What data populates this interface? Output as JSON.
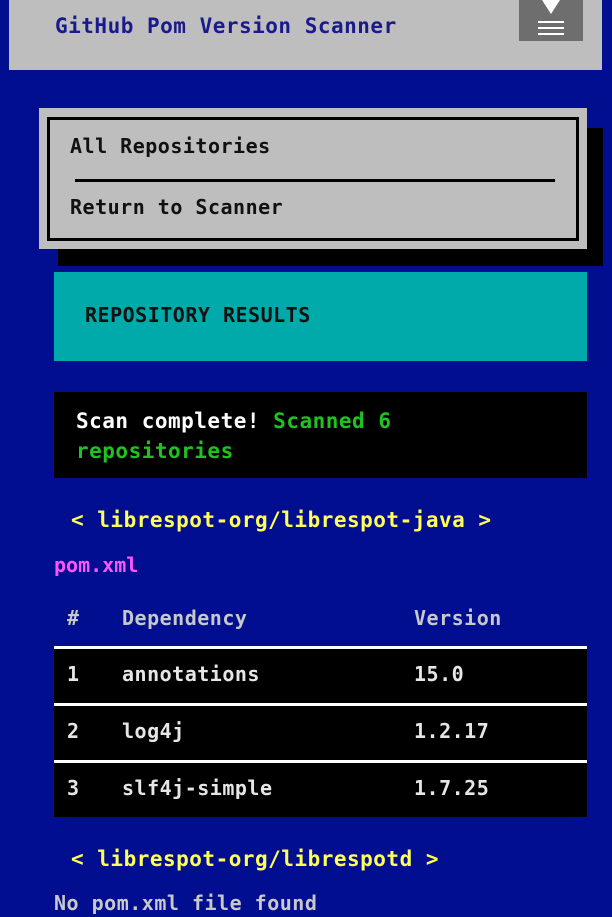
{
  "header": {
    "title": "GitHub Pom Version Scanner",
    "menu_icon": "hamburger-menu-icon"
  },
  "dropdown": {
    "items": [
      {
        "label": "All Repositories"
      },
      {
        "label": "Return to Scanner"
      }
    ]
  },
  "results_banner": {
    "title": "REPOSITORY RESULTS"
  },
  "status": {
    "strong": "Scan complete!",
    "message": "Scanned 6 repositories"
  },
  "repos": [
    {
      "name": "< librespot-org/librespot-java >",
      "file": "pom.xml",
      "columns": [
        "#",
        "Dependency",
        "Version"
      ],
      "rows": [
        {
          "num": "1",
          "dependency": "annotations",
          "version": "15.0"
        },
        {
          "num": "2",
          "dependency": "log4j",
          "version": "1.2.17"
        },
        {
          "num": "3",
          "dependency": "slf4j-simple",
          "version": "1.7.25"
        }
      ]
    },
    {
      "name": "< librespot-org/librespotd >",
      "message": "No pom.xml file found"
    }
  ],
  "colors": {
    "background": "#000e8f",
    "header": "#bebebe",
    "banner": "#00aaaa",
    "link": "#ffff55",
    "file": "#ff55ff",
    "success": "#1fc31f"
  }
}
